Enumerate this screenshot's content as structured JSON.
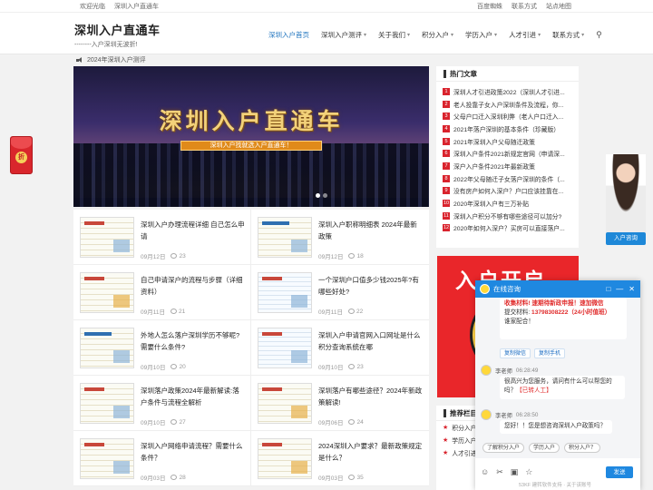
{
  "topbar": {
    "left": [
      "欢迎光临",
      "深圳入户直通车"
    ],
    "right": [
      "百度蜘蛛",
      "联系方式",
      "站点地图"
    ]
  },
  "site": {
    "name": "深圳入户直通车",
    "slogan": "--------入户深圳无波折!"
  },
  "nav": [
    {
      "label": "深圳入户首页",
      "caret": false,
      "active": true
    },
    {
      "label": "深圳入户测评",
      "caret": true
    },
    {
      "label": "关于我们",
      "caret": true
    },
    {
      "label": "积分入户",
      "caret": true
    },
    {
      "label": "学历入户",
      "caret": true
    },
    {
      "label": "人才引进",
      "caret": true
    },
    {
      "label": "联系方式",
      "caret": true
    }
  ],
  "nav_search_icon": "search-icon",
  "notice": "2024年深圳入户测评",
  "banner": {
    "title": "深圳入户直通车",
    "ribbon": "深圳入户找就选入户直通车！",
    "active_slide": 1,
    "slides": 3
  },
  "articles": [
    {
      "title": "深圳入户办理流程详细 自己怎么申请",
      "date": "09月12日",
      "comments": "23"
    },
    {
      "title": "深圳入户职称明细表 2024年最新政策",
      "date": "09月12日",
      "comments": "18"
    },
    {
      "title": "自己申请深户的流程与步骤（详细资料）",
      "date": "09月11日",
      "comments": "21"
    },
    {
      "title": "一个深圳户口值多少钱2025年?有哪些好处?",
      "date": "09月11日",
      "comments": "22"
    },
    {
      "title": "外地人怎么落户深圳学历不够呢?需要什么条件?",
      "date": "09月10日",
      "comments": "20"
    },
    {
      "title": "深圳入户申请官网入口网址是什么 积分查询系统在哪",
      "date": "09月10日",
      "comments": "23"
    },
    {
      "title": "深圳落户政策2024年最新解读:落户条件与流程全解析",
      "date": "09月10日",
      "comments": "27"
    },
    {
      "title": "深圳落户有哪些途径？2024年新政策解读!",
      "date": "09月06日",
      "comments": "24"
    },
    {
      "title": "深圳入户网络申请流程？需要什么条件？",
      "date": "09月03日",
      "comments": "28"
    },
    {
      "title": "2024深圳入户要求？最新政策规定是什么？",
      "date": "09月03日",
      "comments": "35"
    }
  ],
  "hot": {
    "title": "热门文章",
    "items": [
      "深圳人才引进政策2022（深圳人才引进...",
      "老人投靠子女入户深圳条件及流程，你...",
      "父母户口迁入深圳利弊（老人户口迁入...",
      "2021年落户深圳的基本条件（珍藏版）",
      "2021年深圳入户父母随迁政策",
      "深圳入户条件2021新规定官网（申请深...",
      "深户入户条件2021年最新政策",
      "2022年父母随迁子女落户深圳的条件（...",
      "没有房产如何入深户？户口应该挂靠在...",
      "2020年深圳入户有三万补贴",
      "深圳入户积分不够有哪些途径可以加分?",
      "2020年如何入深户？买房可以直接落户..."
    ]
  },
  "promo": {
    "text": "入户开启"
  },
  "recommend": {
    "title": "推荐栏目",
    "items": [
      "积分入户",
      "学历入户",
      "人才引进"
    ]
  },
  "envelope": {
    "label": "折"
  },
  "agent": {
    "button": "入户咨询"
  },
  "chat": {
    "title": "在线咨询",
    "msg1_lines": [
      "收集材料! 速期待新政申报！速加微信",
      "提交材料: "
    ],
    "msg1_phone": "13798308222（24小时值班）",
    "msg1_tail": "谁家配合！",
    "btn_copy_wechat": "复制微信",
    "btn_copy_phone": "复制手机",
    "sender": "李老师",
    "time1": "06:28:49",
    "msg2": "很高兴为您服务，请问有什么可以帮您的吗？",
    "msg2_tag": "【已转人工】",
    "time2": "06:28:50",
    "msg3": "您好！！您是想咨询深圳入户政策吗？",
    "quick": [
      "了解积分入户",
      "学历入户",
      "积分入户？"
    ],
    "send": "发送",
    "powered": "53KF 建转软件支持 · 关于该账号"
  }
}
